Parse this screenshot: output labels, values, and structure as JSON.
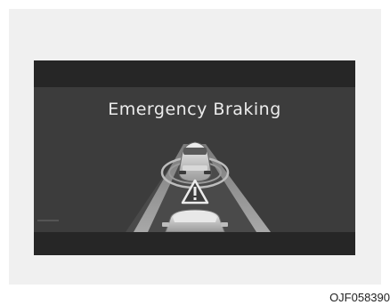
{
  "display": {
    "title": "Emergency Braking",
    "icons": [
      "lead-vehicle-icon",
      "warning-triangle-icon",
      "own-vehicle-icon"
    ]
  },
  "caption": "OJF058390",
  "colors": {
    "screen": "#3c3c3c",
    "bars": "#262626",
    "text": "#ececec"
  }
}
